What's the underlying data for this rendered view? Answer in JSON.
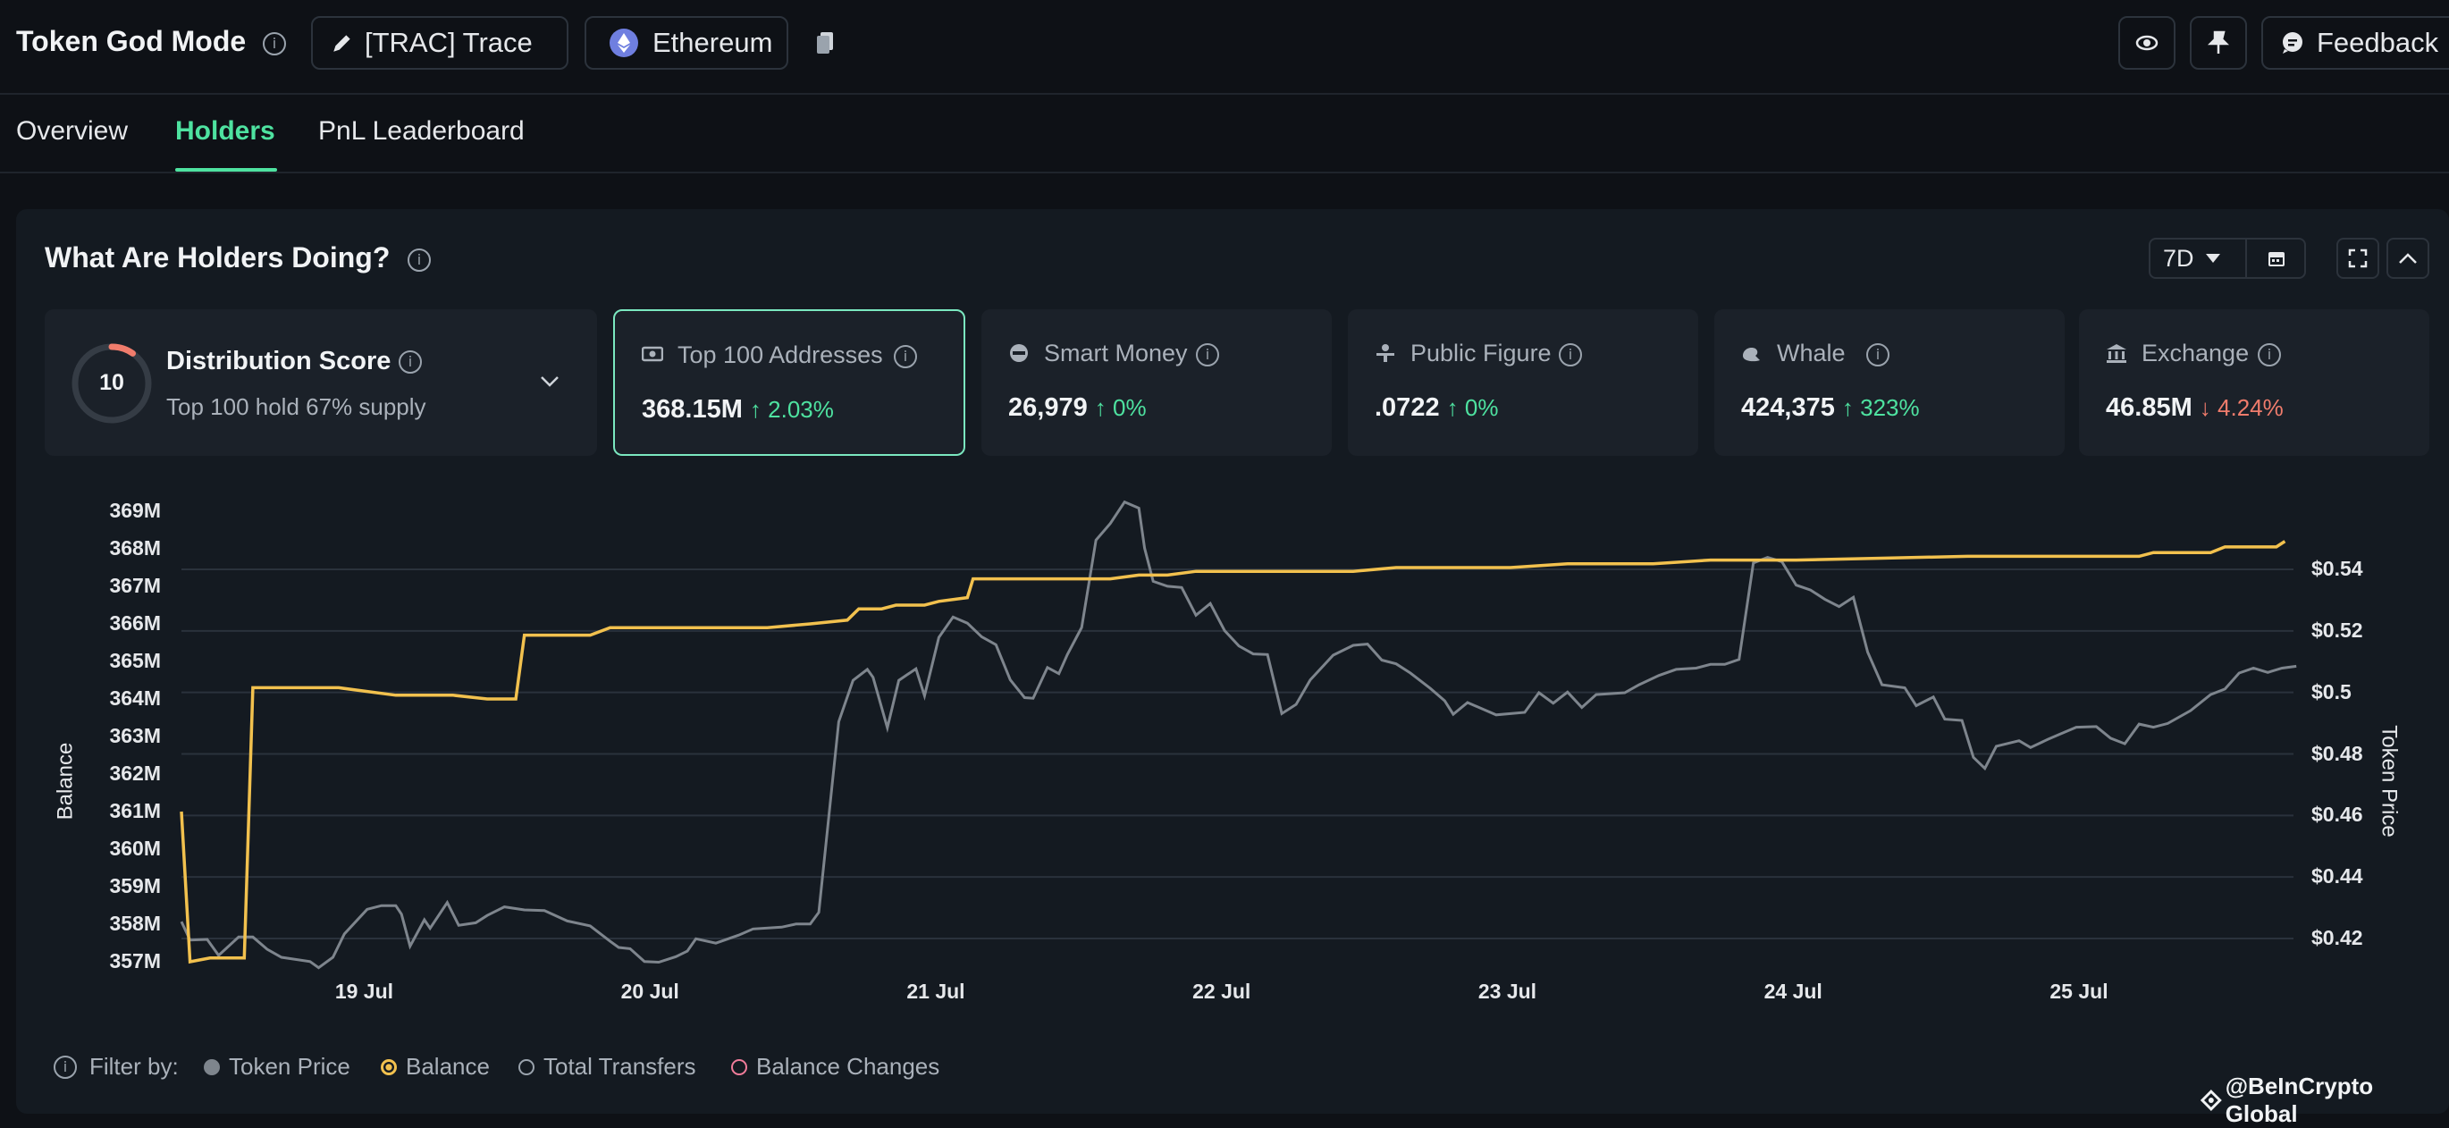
{
  "header": {
    "title": "Token God Mode",
    "token_button": "[TRAC] Trace",
    "chain_button": "Ethereum",
    "feedback_button": "Feedback"
  },
  "tabs": [
    {
      "label": "Overview"
    },
    {
      "label": "Holders"
    },
    {
      "label": "PnL Leaderboard"
    }
  ],
  "section": {
    "title": "What Are Holders Doing?",
    "period": "7D"
  },
  "distribution": {
    "score": "10",
    "title": "Distribution Score",
    "subtitle": "Top 100 hold 67% supply"
  },
  "cards": [
    {
      "label": "Top 100 Addresses",
      "value": "368.15M",
      "change": "2.03%",
      "direction": "up",
      "icon": "money-icon"
    },
    {
      "label": "Smart Money",
      "value": "26,979",
      "change": "0%",
      "direction": "up",
      "icon": "brain-icon"
    },
    {
      "label": "Public Figure",
      "value": ".0722",
      "change": "0%",
      "direction": "up",
      "icon": "podium-icon"
    },
    {
      "label": "Whale",
      "value": "424,375",
      "change": "323%",
      "direction": "up",
      "icon": "whale-icon"
    },
    {
      "label": "Exchange",
      "value": "46.85M",
      "change": "4.24%",
      "direction": "down",
      "icon": "bank-icon"
    }
  ],
  "filter": {
    "label": "Filter by:",
    "options": [
      {
        "label": "Token Price"
      },
      {
        "label": "Balance"
      },
      {
        "label": "Total Transfers"
      },
      {
        "label": "Balance Changes"
      }
    ]
  },
  "watermark": "@BeInCrypto Global",
  "colors": {
    "accent": "#4ee2a0",
    "balance": "#f2c14e",
    "price": "#7e858d",
    "down": "#f07c6c"
  },
  "chart_data": {
    "type": "line",
    "ylabel_left": "Balance",
    "ylabel_right": "Token Price",
    "y_left_ticks": [
      "369M",
      "368M",
      "367M",
      "366M",
      "365M",
      "364M",
      "363M",
      "362M",
      "361M",
      "360M",
      "359M",
      "358M",
      "357M"
    ],
    "y_right_ticks": [
      "$0.54",
      "$0.52",
      "$0.5",
      "$0.48",
      "$0.46",
      "$0.44",
      "$0.42"
    ],
    "x_ticks": [
      "19 Jul",
      "20 Jul",
      "21 Jul",
      "22 Jul",
      "23 Jul",
      "24 Jul",
      "25 Jul"
    ],
    "ylim_left": [
      357,
      369
    ],
    "ylim_right": [
      0.41,
      0.55
    ],
    "xlim": [
      18.35,
      25.74
    ],
    "series": [
      {
        "name": "Balance",
        "unit": "M",
        "points": [
          [
            18.35,
            361.0
          ],
          [
            18.38,
            357.0
          ],
          [
            18.45,
            357.1
          ],
          [
            18.55,
            357.1
          ],
          [
            18.57,
            357.1
          ],
          [
            18.6,
            364.3
          ],
          [
            18.7,
            364.3
          ],
          [
            18.8,
            364.3
          ],
          [
            18.9,
            364.3
          ],
          [
            19.0,
            364.2
          ],
          [
            19.1,
            364.1
          ],
          [
            19.3,
            364.1
          ],
          [
            19.42,
            364.0
          ],
          [
            19.5,
            364.0
          ],
          [
            19.52,
            364.0
          ],
          [
            19.55,
            365.7
          ],
          [
            19.7,
            365.7
          ],
          [
            19.78,
            365.7
          ],
          [
            19.85,
            365.9
          ],
          [
            20.0,
            365.9
          ],
          [
            20.2,
            365.9
          ],
          [
            20.4,
            365.9
          ],
          [
            20.55,
            366.0
          ],
          [
            20.68,
            366.1
          ],
          [
            20.72,
            366.4
          ],
          [
            20.8,
            366.4
          ],
          [
            20.85,
            366.5
          ],
          [
            20.95,
            366.5
          ],
          [
            21.0,
            366.6
          ],
          [
            21.1,
            366.7
          ],
          [
            21.12,
            367.2
          ],
          [
            21.25,
            367.2
          ],
          [
            21.35,
            367.2
          ],
          [
            21.5,
            367.2
          ],
          [
            21.6,
            367.2
          ],
          [
            21.7,
            367.3
          ],
          [
            21.8,
            367.3
          ],
          [
            21.9,
            367.4
          ],
          [
            22.0,
            367.4
          ],
          [
            22.1,
            367.4
          ],
          [
            22.3,
            367.4
          ],
          [
            22.45,
            367.4
          ],
          [
            22.6,
            367.5
          ],
          [
            22.75,
            367.5
          ],
          [
            23.0,
            367.5
          ],
          [
            23.2,
            367.6
          ],
          [
            23.5,
            367.6
          ],
          [
            23.7,
            367.7
          ],
          [
            24.0,
            367.7
          ],
          [
            24.3,
            367.75
          ],
          [
            24.6,
            367.8
          ],
          [
            25.0,
            367.8
          ],
          [
            25.2,
            367.8
          ],
          [
            25.25,
            367.9
          ],
          [
            25.45,
            367.9
          ],
          [
            25.5,
            368.05
          ],
          [
            25.6,
            368.05
          ],
          [
            25.68,
            368.05
          ],
          [
            25.71,
            368.2
          ]
        ]
      },
      {
        "name": "Token Price",
        "unit": "$",
        "points": [
          [
            18.35,
            0.4255
          ],
          [
            18.38,
            0.4195
          ],
          [
            18.44,
            0.4197
          ],
          [
            18.48,
            0.4145
          ],
          [
            18.55,
            0.4205
          ],
          [
            18.6,
            0.4205
          ],
          [
            18.65,
            0.4165
          ],
          [
            18.7,
            0.4139
          ],
          [
            18.8,
            0.4125
          ],
          [
            18.83,
            0.4105
          ],
          [
            18.88,
            0.4139
          ],
          [
            18.92,
            0.4215
          ],
          [
            19.0,
            0.4295
          ],
          [
            19.05,
            0.4307
          ],
          [
            19.1,
            0.4307
          ],
          [
            19.12,
            0.4279
          ],
          [
            19.15,
            0.4175
          ],
          [
            19.2,
            0.4261
          ],
          [
            19.22,
            0.4233
          ],
          [
            19.28,
            0.4317
          ],
          [
            19.32,
            0.4243
          ],
          [
            19.38,
            0.4251
          ],
          [
            19.42,
            0.4275
          ],
          [
            19.48,
            0.4303
          ],
          [
            19.55,
            0.4293
          ],
          [
            19.62,
            0.4291
          ],
          [
            19.7,
            0.4257
          ],
          [
            19.78,
            0.4241
          ],
          [
            19.85,
            0.4191
          ],
          [
            19.88,
            0.4171
          ],
          [
            19.92,
            0.4167
          ],
          [
            19.97,
            0.4125
          ],
          [
            20.02,
            0.4123
          ],
          [
            20.08,
            0.4141
          ],
          [
            20.12,
            0.4159
          ],
          [
            20.15,
            0.4199
          ],
          [
            20.22,
            0.4185
          ],
          [
            20.3,
            0.4211
          ],
          [
            20.35,
            0.4231
          ],
          [
            20.45,
            0.4237
          ],
          [
            20.5,
            0.4247
          ],
          [
            20.55,
            0.4247
          ],
          [
            20.58,
            0.4285
          ],
          [
            20.65,
            0.4905
          ],
          [
            20.7,
            0.5039
          ],
          [
            20.75,
            0.5075
          ],
          [
            20.77,
            0.5049
          ],
          [
            20.82,
            0.4885
          ],
          [
            20.86,
            0.5039
          ],
          [
            20.92,
            0.5077
          ],
          [
            20.95,
            0.4989
          ],
          [
            21.0,
            0.5179
          ],
          [
            21.05,
            0.5245
          ],
          [
            21.1,
            0.5225
          ],
          [
            21.15,
            0.5181
          ],
          [
            21.2,
            0.5155
          ],
          [
            21.25,
            0.5041
          ],
          [
            21.3,
            0.4983
          ],
          [
            21.33,
            0.4981
          ],
          [
            21.38,
            0.5081
          ],
          [
            21.42,
            0.5061
          ],
          [
            21.45,
            0.5123
          ],
          [
            21.5,
            0.5211
          ],
          [
            21.55,
            0.5495
          ],
          [
            21.6,
            0.5549
          ],
          [
            21.65,
            0.5619
          ],
          [
            21.7,
            0.5599
          ],
          [
            21.72,
            0.5469
          ],
          [
            21.75,
            0.5361
          ],
          [
            21.8,
            0.5345
          ],
          [
            21.85,
            0.5341
          ],
          [
            21.9,
            0.5251
          ],
          [
            21.95,
            0.5289
          ],
          [
            22.0,
            0.5201
          ],
          [
            22.05,
            0.5151
          ],
          [
            22.1,
            0.5125
          ],
          [
            22.15,
            0.5123
          ],
          [
            22.2,
            0.4931
          ],
          [
            22.25,
            0.4961
          ],
          [
            22.3,
            0.5041
          ],
          [
            22.38,
            0.5121
          ],
          [
            22.45,
            0.5153
          ],
          [
            22.5,
            0.5157
          ],
          [
            22.55,
            0.5105
          ],
          [
            22.6,
            0.5093
          ],
          [
            22.65,
            0.5063
          ],
          [
            22.72,
            0.5013
          ],
          [
            22.77,
            0.4973
          ],
          [
            22.8,
            0.4929
          ],
          [
            22.85,
            0.4967
          ],
          [
            22.9,
            0.4947
          ],
          [
            22.95,
            0.4927
          ],
          [
            23.05,
            0.4935
          ],
          [
            23.1,
            0.4999
          ],
          [
            23.15,
            0.4965
          ],
          [
            23.2,
            0.5001
          ],
          [
            23.25,
            0.4951
          ],
          [
            23.3,
            0.4993
          ],
          [
            23.4,
            0.4999
          ],
          [
            23.45,
            0.5025
          ],
          [
            23.52,
            0.5055
          ],
          [
            23.58,
            0.5075
          ],
          [
            23.65,
            0.5079
          ],
          [
            23.7,
            0.5091
          ],
          [
            23.75,
            0.5091
          ],
          [
            23.8,
            0.5107
          ],
          [
            23.85,
            0.5421
          ],
          [
            23.9,
            0.5439
          ],
          [
            23.95,
            0.5425
          ],
          [
            24.0,
            0.5349
          ],
          [
            24.05,
            0.5333
          ],
          [
            24.1,
            0.5303
          ],
          [
            24.15,
            0.5279
          ],
          [
            24.2,
            0.5309
          ],
          [
            24.25,
            0.5131
          ],
          [
            24.3,
            0.5025
          ],
          [
            24.38,
            0.5015
          ],
          [
            24.42,
            0.4957
          ],
          [
            24.48,
            0.4985
          ],
          [
            24.52,
            0.4913
          ],
          [
            24.58,
            0.4909
          ],
          [
            24.62,
            0.4789
          ],
          [
            24.66,
            0.4753
          ],
          [
            24.7,
            0.4825
          ],
          [
            24.78,
            0.4843
          ],
          [
            24.82,
            0.4821
          ],
          [
            24.88,
            0.4847
          ],
          [
            24.92,
            0.4863
          ],
          [
            24.98,
            0.4887
          ],
          [
            25.05,
            0.4889
          ],
          [
            25.1,
            0.4851
          ],
          [
            25.15,
            0.4833
          ],
          [
            25.2,
            0.4897
          ],
          [
            25.25,
            0.4887
          ],
          [
            25.3,
            0.4899
          ],
          [
            25.38,
            0.4941
          ],
          [
            25.45,
            0.4993
          ],
          [
            25.5,
            0.5011
          ],
          [
            25.55,
            0.5063
          ],
          [
            25.6,
            0.5079
          ],
          [
            25.65,
            0.5065
          ],
          [
            25.7,
            0.5079
          ],
          [
            25.75,
            0.5085
          ]
        ]
      }
    ]
  }
}
